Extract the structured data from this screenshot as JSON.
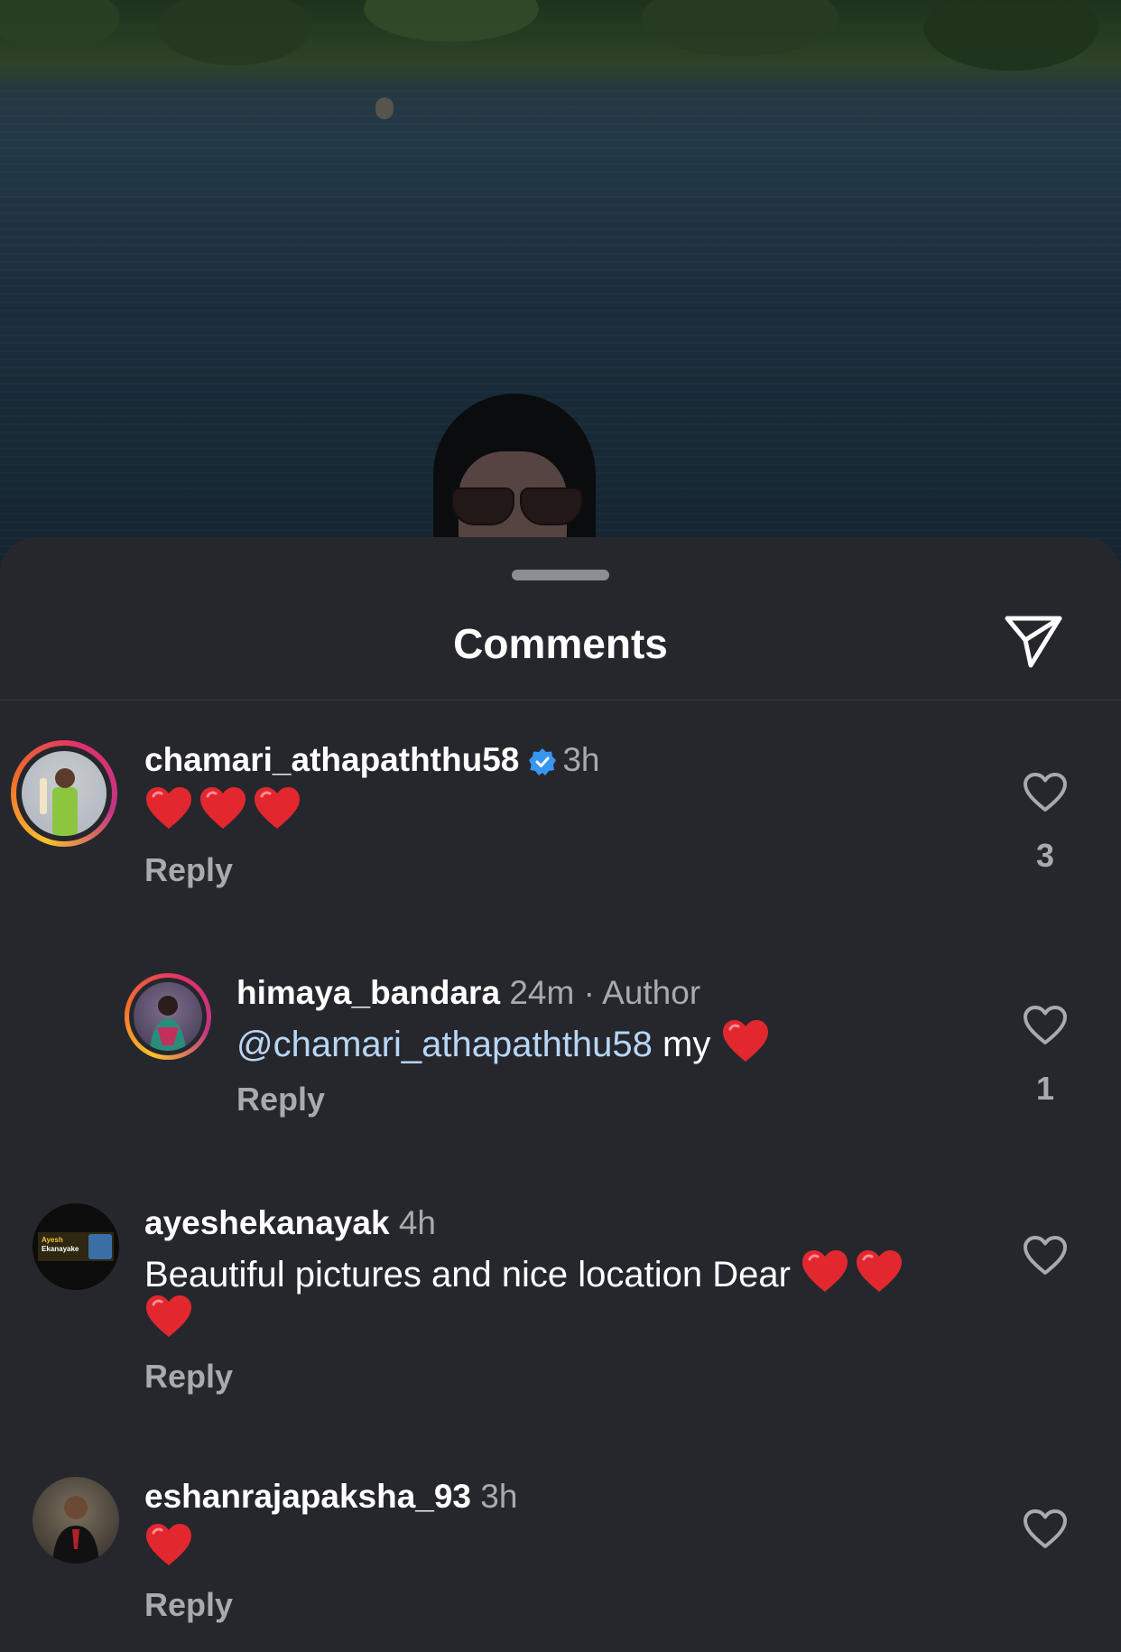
{
  "sheet": {
    "title": "Comments"
  },
  "comments": [
    {
      "username": "chamari_athapaththu58",
      "verified": true,
      "time": "3h",
      "text": "",
      "hearts": 3,
      "reply_label": "Reply",
      "likes": "3"
    },
    {
      "username": "himaya_bandara",
      "time": "24m · Author",
      "mention": "@chamari_athapaththu58",
      "text": "my",
      "hearts": 1,
      "reply_label": "Reply",
      "likes": "1"
    },
    {
      "username": "ayeshekanayak",
      "time": "4h",
      "text": "Beautiful pictures and nice location Dear",
      "hearts": 3,
      "reply_label": "Reply",
      "avatar_text_line1": "Ayesh",
      "avatar_text_line2": "Ekanayake"
    },
    {
      "username": "eshanrajapaksha_93",
      "time": "3h",
      "text": "",
      "hearts": 1,
      "reply_label": "Reply"
    }
  ],
  "icons": {
    "share": "paper-plane-icon",
    "like": "heart-outline-icon",
    "verified": "verified-badge-icon",
    "heart_emoji": "red-heart-emoji"
  },
  "colors": {
    "sheet_bg": "#25272d",
    "secondary_text": "#a8aaae",
    "mention": "#b8d6f5",
    "verified": "#3797f0",
    "heart": "#e3272f"
  }
}
